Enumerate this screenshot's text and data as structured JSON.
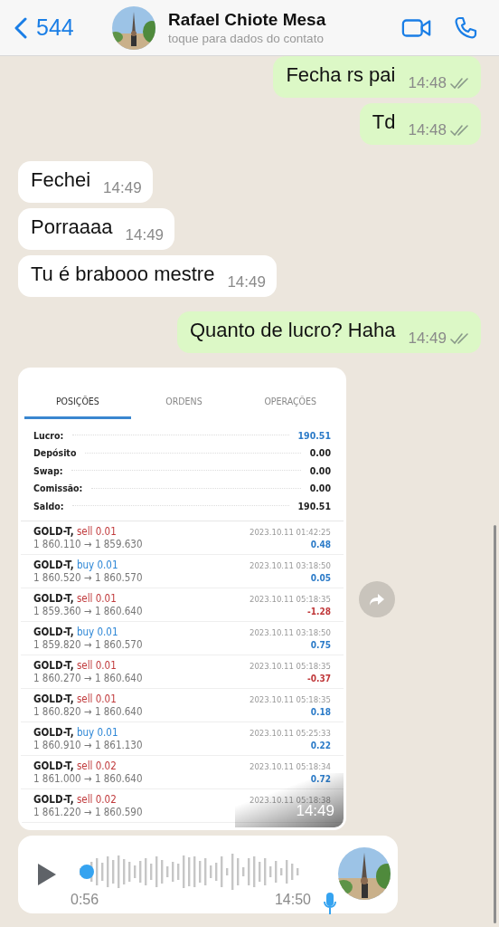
{
  "header": {
    "back_count": "544",
    "contact_name": "Rafael Chiote Mesa",
    "subtitle": "toque para dados do contato"
  },
  "messages": [
    {
      "kind": "outgoing",
      "text": "Fecha rs pai",
      "time": "14:48",
      "read": false
    },
    {
      "kind": "outgoing",
      "text": "Td",
      "time": "14:48",
      "read": false
    },
    {
      "kind": "incoming",
      "text": "Fechei",
      "time": "14:49"
    },
    {
      "kind": "incoming",
      "text": "Porraaaa",
      "time": "14:49"
    },
    {
      "kind": "incoming",
      "text": "Tu é brabooo mestre",
      "time": "14:49"
    },
    {
      "kind": "outgoing",
      "text": "Quanto de lucro? Haha",
      "time": "14:49",
      "read": false
    }
  ],
  "image_message": {
    "time": "14:49",
    "tabs": [
      {
        "label": "POSIÇÕES",
        "selected": true
      },
      {
        "label": "ORDENS",
        "selected": false
      },
      {
        "label": "OPERAÇÕES",
        "selected": false
      }
    ],
    "summary": [
      {
        "label": "Lucro:",
        "value": "190.51",
        "highlight": true
      },
      {
        "label": "Depósito",
        "value": "0.00",
        "highlight": false
      },
      {
        "label": "Swap:",
        "value": "0.00",
        "highlight": false
      },
      {
        "label": "Comissão:",
        "value": "0.00",
        "highlight": false
      },
      {
        "label": "Saldo:",
        "value": "190.51",
        "highlight": false
      }
    ],
    "trades": [
      {
        "symbol": "GOLD-T,",
        "kind": "sell",
        "side": "sell 0.01",
        "prices": "1 860.110 → 1 859.630",
        "time": "2023.10.11 01:42:25",
        "profit": "0.48",
        "color": "#2c7bc8"
      },
      {
        "symbol": "GOLD-T,",
        "kind": "buy",
        "side": "buy 0.01",
        "prices": "1 860.520 → 1 860.570",
        "time": "2023.10.11 03:18:50",
        "profit": "0.05",
        "color": "#2c7bc8"
      },
      {
        "symbol": "GOLD-T,",
        "kind": "sell",
        "side": "sell 0.01",
        "prices": "1 859.360 → 1 860.640",
        "time": "2023.10.11 05:18:35",
        "profit": "-1.28",
        "color": "#c0393b"
      },
      {
        "symbol": "GOLD-T,",
        "kind": "buy",
        "side": "buy 0.01",
        "prices": "1 859.820 → 1 860.570",
        "time": "2023.10.11 03:18:50",
        "profit": "0.75",
        "color": "#2c7bc8"
      },
      {
        "symbol": "GOLD-T,",
        "kind": "sell",
        "side": "sell 0.01",
        "prices": "1 860.270 → 1 860.640",
        "time": "2023.10.11 05:18:35",
        "profit": "-0.37",
        "color": "#c0393b"
      },
      {
        "symbol": "GOLD-T,",
        "kind": "sell",
        "side": "sell 0.01",
        "prices": "1 860.820 → 1 860.640",
        "time": "2023.10.11 05:18:35",
        "profit": "0.18",
        "color": "#2c7bc8"
      },
      {
        "symbol": "GOLD-T,",
        "kind": "buy",
        "side": "buy 0.01",
        "prices": "1 860.910 → 1 861.130",
        "time": "2023.10.11 05:25:33",
        "profit": "0.22",
        "color": "#2c7bc8"
      },
      {
        "symbol": "GOLD-T,",
        "kind": "sell",
        "side": "sell 0.02",
        "prices": "1 861.000 → 1 860.640",
        "time": "2023.10.11 05:18:34",
        "profit": "0.72",
        "color": "#2c7bc8"
      },
      {
        "symbol": "GOLD-T,",
        "kind": "sell",
        "side": "sell 0.02",
        "prices": "1 861.220 → 1 860.590",
        "time": "2023.10.11 05:18:38"
      }
    ]
  },
  "voice_message": {
    "duration": "0:56",
    "time": "14:50"
  }
}
